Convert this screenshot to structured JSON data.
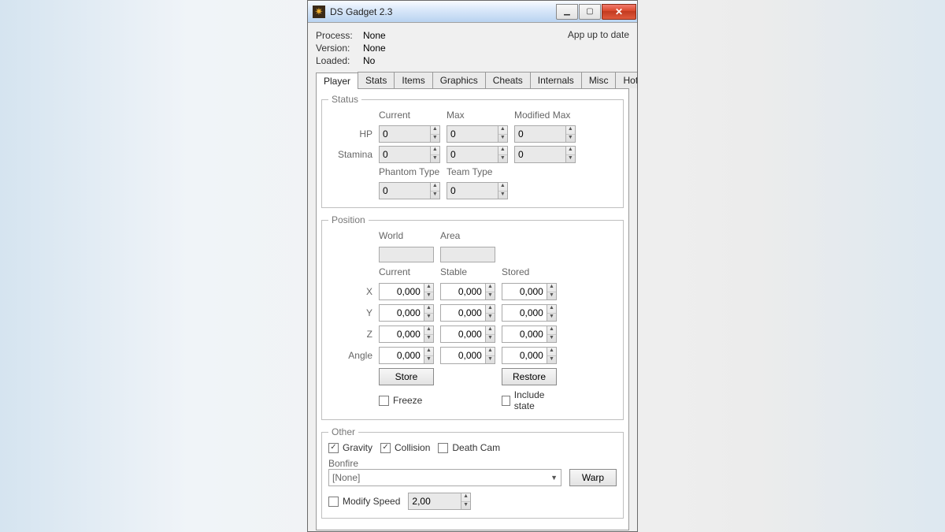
{
  "window": {
    "title": "DS Gadget 2.3"
  },
  "header": {
    "labels": {
      "process": "Process:",
      "version": "Version:",
      "loaded": "Loaded:"
    },
    "values": {
      "process": "None",
      "version": "None",
      "loaded": "No"
    },
    "update_status": "App up to date"
  },
  "tabs": [
    "Player",
    "Stats",
    "Items",
    "Graphics",
    "Cheats",
    "Internals",
    "Misc",
    "Hotkeys"
  ],
  "status": {
    "legend": "Status",
    "cols": {
      "current": "Current",
      "max": "Max",
      "modmax": "Modified Max"
    },
    "rows": {
      "hp": "HP",
      "stamina": "Stamina"
    },
    "hp": {
      "current": "0",
      "max": "0",
      "modmax": "0"
    },
    "stamina": {
      "current": "0",
      "max": "0",
      "modmax": "0"
    },
    "phantom_label": "Phantom Type",
    "team_label": "Team Type",
    "phantom": "0",
    "team": "0"
  },
  "position": {
    "legend": "Position",
    "world_label": "World",
    "area_label": "Area",
    "cols": {
      "current": "Current",
      "stable": "Stable",
      "stored": "Stored"
    },
    "rows": {
      "x": "X",
      "y": "Y",
      "z": "Z",
      "angle": "Angle"
    },
    "x": {
      "current": "0,000",
      "stable": "0,000",
      "stored": "0,000"
    },
    "y": {
      "current": "0,000",
      "stable": "0,000",
      "stored": "0,000"
    },
    "z": {
      "current": "0,000",
      "stable": "0,000",
      "stored": "0,000"
    },
    "angle": {
      "current": "0,000",
      "stable": "0,000",
      "stored": "0,000"
    },
    "store_btn": "Store",
    "restore_btn": "Restore",
    "freeze": "Freeze",
    "include_state": "Include state"
  },
  "other": {
    "legend": "Other",
    "gravity": "Gravity",
    "collision": "Collision",
    "deathcam": "Death Cam",
    "bonfire_label": "Bonfire",
    "bonfire_value": "[None]",
    "warp_btn": "Warp",
    "modify_speed": "Modify Speed",
    "speed_value": "2,00"
  },
  "checked": {
    "gravity": true,
    "collision": true,
    "deathcam": false,
    "freeze": false,
    "include_state": false,
    "modify_speed": false
  }
}
